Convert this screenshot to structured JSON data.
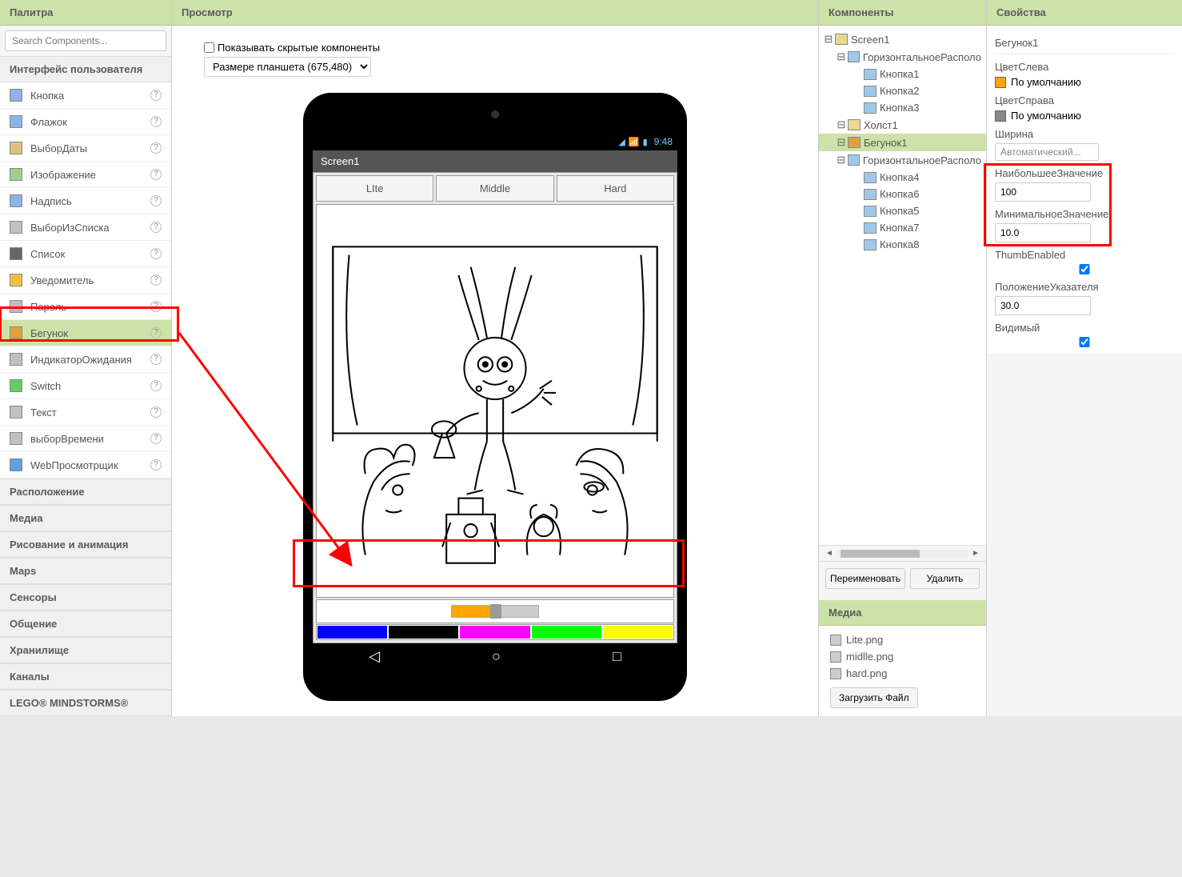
{
  "palette": {
    "header": "Палитра",
    "search_placeholder": "Search Components...",
    "ui_header": "Интерфейс пользователя",
    "items": [
      {
        "label": "Кнопка",
        "icon_bg": "#8cb4e8"
      },
      {
        "label": "Флажок",
        "icon_bg": "#8cb4e8"
      },
      {
        "label": "ВыборДаты",
        "icon_bg": "#e0c080"
      },
      {
        "label": "Изображение",
        "icon_bg": "#a0d090"
      },
      {
        "label": "Надпись",
        "icon_bg": "#8cb4e8"
      },
      {
        "label": "ВыборИзСписка",
        "icon_bg": "#c0c0c0"
      },
      {
        "label": "Список",
        "icon_bg": "#666"
      },
      {
        "label": "Уведомитель",
        "icon_bg": "#f0c040"
      },
      {
        "label": "Пароль",
        "icon_bg": "#c0c0c0"
      },
      {
        "label": "Бегунок",
        "icon_bg": "#e0a040"
      },
      {
        "label": "ИндикаторОжидания",
        "icon_bg": "#c0c0c0"
      },
      {
        "label": "Switch",
        "icon_bg": "#60d060"
      },
      {
        "label": "Текст",
        "icon_bg": "#c0c0c0"
      },
      {
        "label": "выборВремени",
        "icon_bg": "#c0c0c0"
      },
      {
        "label": "WebПросмотрщик",
        "icon_bg": "#60a0e0"
      }
    ],
    "categories": [
      "Расположение",
      "Медиа",
      "Рисование и анимация",
      "Maps",
      "Сенсоры",
      "Общение",
      "Хранилище",
      "Каналы",
      "LEGO® MINDSTORMS®"
    ]
  },
  "viewer": {
    "header": "Просмотр",
    "show_hidden": "Показывать скрытые компоненты",
    "size_option": "Размере планшета (675,480)",
    "android_time": "9:48",
    "screen_title": "Screen1",
    "tabs": [
      "LIte",
      "Middle",
      "Hard"
    ],
    "colors": [
      "#0000ff",
      "#000000",
      "#ff00ff",
      "#00ff00",
      "#ffff00"
    ]
  },
  "components": {
    "header": "Компоненты",
    "tree": [
      {
        "label": "Screen1",
        "indent": 0,
        "icon": "#e8d890"
      },
      {
        "label": "ГоризонтальноеРасполо",
        "indent": 1,
        "icon": "#a0c8e8"
      },
      {
        "label": "Кнопка1",
        "indent": 2,
        "icon": "#a0c8e8"
      },
      {
        "label": "Кнопка2",
        "indent": 2,
        "icon": "#a0c8e8"
      },
      {
        "label": "Кнопка3",
        "indent": 2,
        "icon": "#a0c8e8"
      },
      {
        "label": "Холст1",
        "indent": 1,
        "icon": "#e8d890"
      },
      {
        "label": "Бегунок1",
        "indent": 1,
        "icon": "#e0a040",
        "selected": true
      },
      {
        "label": "ГоризонтальноеРасполо",
        "indent": 1,
        "icon": "#a0c8e8"
      },
      {
        "label": "Кнопка4",
        "indent": 2,
        "icon": "#a0c8e8"
      },
      {
        "label": "Кнопка6",
        "indent": 2,
        "icon": "#a0c8e8"
      },
      {
        "label": "Кнопка5",
        "indent": 2,
        "icon": "#a0c8e8"
      },
      {
        "label": "Кнопка7",
        "indent": 2,
        "icon": "#a0c8e8"
      },
      {
        "label": "Кнопка8",
        "indent": 2,
        "icon": "#a0c8e8"
      }
    ],
    "rename": "Переименовать",
    "delete": "Удалить"
  },
  "media": {
    "header": "Медиа",
    "files": [
      "Lite.png",
      "midlle.png",
      "hard.png"
    ],
    "upload": "Загрузить Файл"
  },
  "properties": {
    "header": "Свойства",
    "selected": "Бегунок1",
    "color_left_label": "ЦветСлева",
    "color_left_value": "По умолчанию",
    "color_left_swatch": "#ffa500",
    "color_right_label": "ЦветСправа",
    "color_right_value": "По умолчанию",
    "color_right_swatch": "#888888",
    "width_label": "Ширина",
    "width_value": "Автоматический...",
    "max_label": "НаибольшееЗначение",
    "max_value": "100",
    "min_label": "МинимальноеЗначение",
    "min_value": "10.0",
    "thumb_label": "ThumbEnabled",
    "pos_label": "ПоложениеУказателя",
    "pos_value": "30.0",
    "visible_label": "Видимый"
  }
}
